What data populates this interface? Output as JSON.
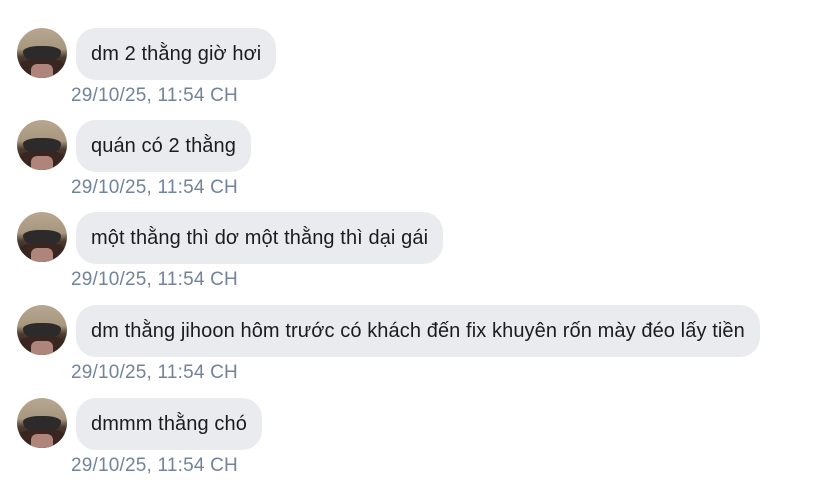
{
  "messages": [
    {
      "text": "dm 2 thằng giờ hơi",
      "time": "29/10/25, 11:54 CH"
    },
    {
      "text": "quán có 2 thằng",
      "time": "29/10/25, 11:54 CH"
    },
    {
      "text": "một thằng thì dơ một thằng thì dại gái",
      "time": "29/10/25, 11:54 CH"
    },
    {
      "text": "dm thằng jihoon hôm trước có khách đến fix khuyên rốn mày đéo lấy tiền",
      "time": "29/10/25, 11:54 CH"
    },
    {
      "text": "dmmm thằng chó",
      "time": "29/10/25, 11:54 CH"
    }
  ],
  "colors": {
    "bubble": "#e9ebef",
    "text": "#1c1c1e",
    "timestamp": "#72839b"
  },
  "icons": {
    "avatar": "user-avatar-photo"
  }
}
